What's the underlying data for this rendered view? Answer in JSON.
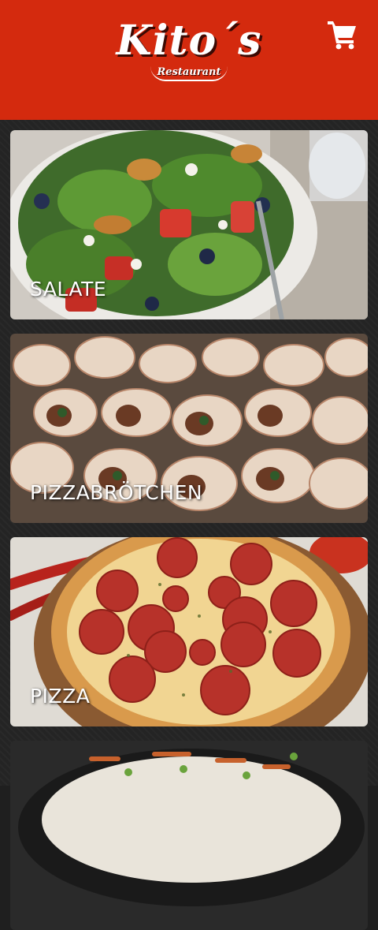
{
  "header": {
    "logo_title": "Kito´s",
    "logo_subtitle": "Restaurant",
    "cart_icon": "shopping-cart-icon"
  },
  "colors": {
    "header_bg": "#d42a0e",
    "page_bg": "#242424",
    "label_text": "#ffffff"
  },
  "categories": [
    {
      "label": "SALATE"
    },
    {
      "label": "PIZZABRÖTCHEN"
    },
    {
      "label": "PIZZA"
    },
    {
      "label": ""
    }
  ]
}
